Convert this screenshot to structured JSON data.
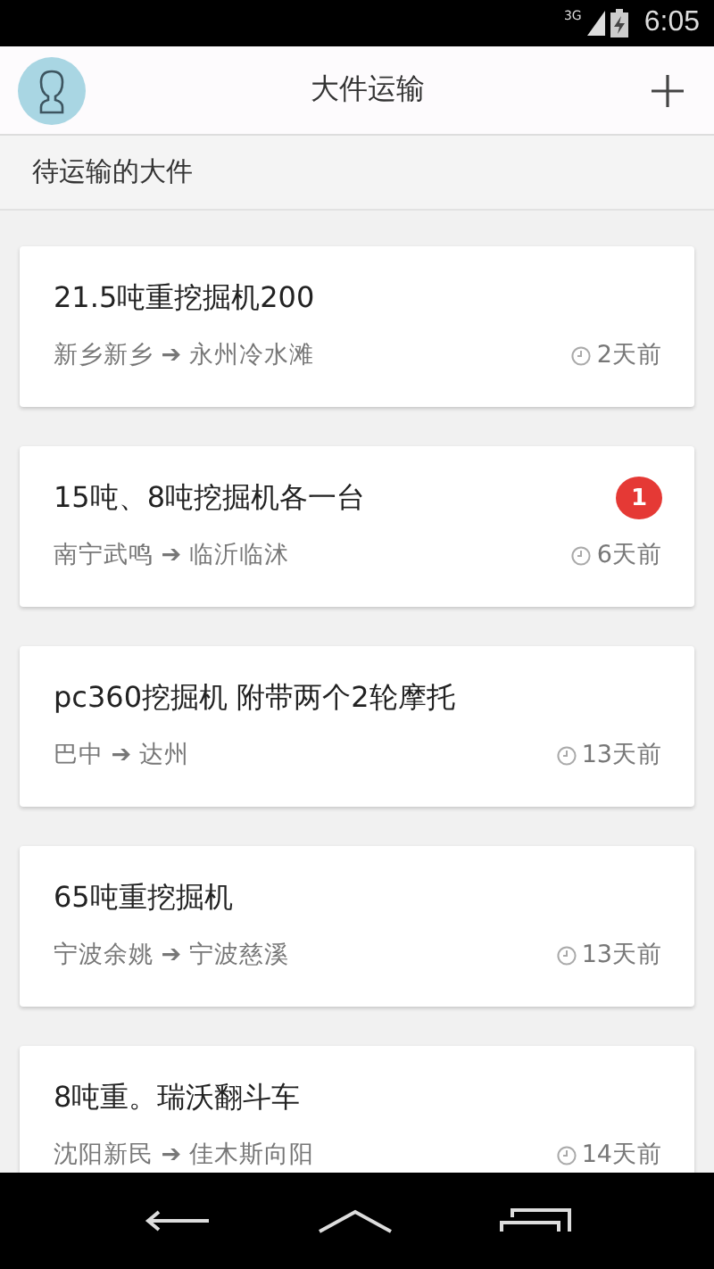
{
  "status_bar": {
    "network": "3G",
    "time": "6:05"
  },
  "app_bar": {
    "title": "大件运输"
  },
  "section": {
    "title": "待运输的大件"
  },
  "items": [
    {
      "title": "21.5吨重挖掘机200",
      "route": "新乡新乡 ➔ 永州冷水滩",
      "age": "2天前"
    },
    {
      "title": "15吨、8吨挖掘机各一台",
      "route": "南宁武鸣 ➔ 临沂临沭",
      "age": "6天前",
      "badge": "1"
    },
    {
      "title": "pc360挖掘机 附带两个2轮摩托",
      "route": "巴中 ➔ 达州",
      "age": "13天前"
    },
    {
      "title": "65吨重挖掘机",
      "route": "宁波余姚 ➔ 宁波慈溪",
      "age": "13天前"
    },
    {
      "title": "8吨重。瑞沃翻斗车",
      "route": "沈阳新民 ➔ 佳木斯向阳",
      "age": "14天前"
    }
  ]
}
